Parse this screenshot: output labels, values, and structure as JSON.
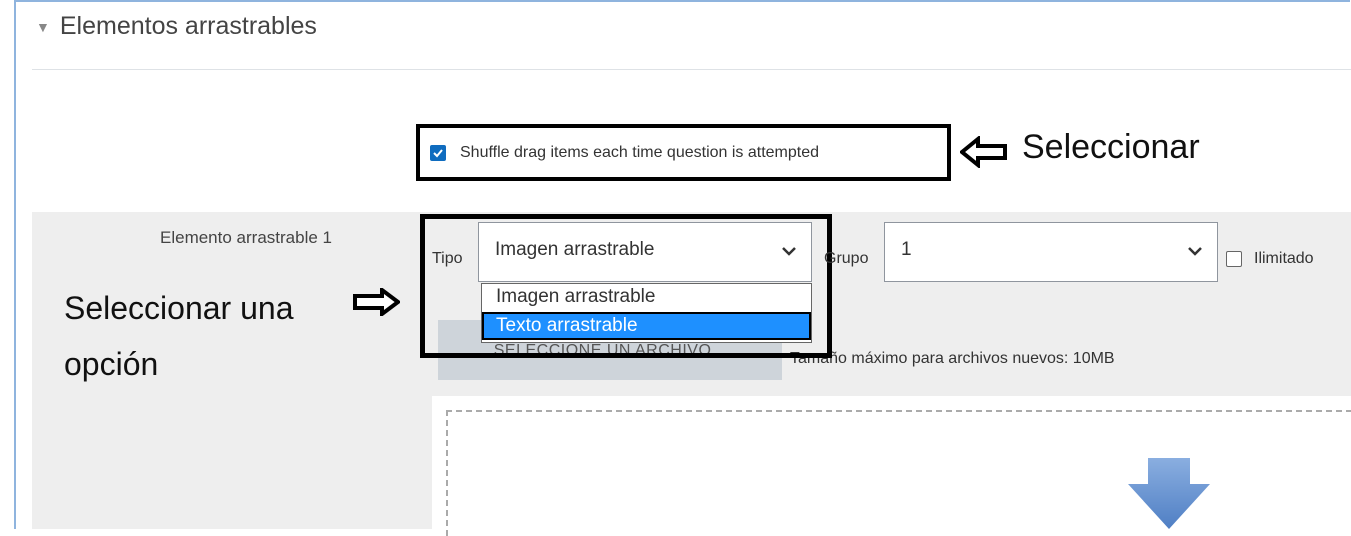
{
  "section": {
    "title": "Elementos arrastrables"
  },
  "shuffle": {
    "label": "Shuffle drag items each time question is attempted",
    "checked": true
  },
  "annotations": {
    "select": "Seleccionar",
    "select_option_line1": "Seleccionar una",
    "select_option_line2": "opción"
  },
  "item": {
    "label": "Elemento arrastrable 1",
    "tipo_label": "Tipo",
    "tipo_value": "Imagen arrastrable",
    "tipo_options": [
      "Imagen arrastrable",
      "Texto arrastrable"
    ],
    "grupo_label": "Grupo",
    "grupo_value": "1",
    "ilimitado_label": "Ilimitado",
    "file_button": "SELECCIONE UN ARCHIVO...",
    "max_size": "Tamaño máximo para archivos nuevos: 10MB"
  },
  "colors": {
    "accent": "#0f6cbf",
    "selected_option": "#1e90ff",
    "panel_bg": "#eeeeee"
  },
  "icons": {
    "collapse": "caret-down-icon",
    "annotation_left": "arrow-left-icon",
    "annotation_right": "arrow-right-icon",
    "drop": "down-arrow-icon"
  }
}
